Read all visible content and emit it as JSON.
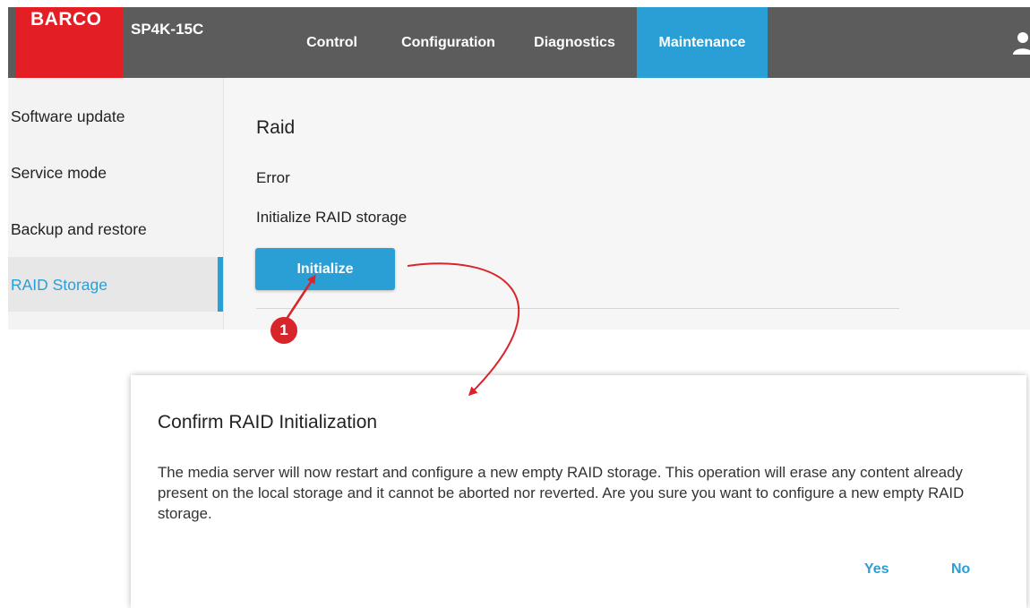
{
  "header": {
    "logo_text": "BARCO",
    "model": "SP4K-15C",
    "tabs": [
      {
        "label": "Control"
      },
      {
        "label": "Configuration"
      },
      {
        "label": "Diagnostics"
      },
      {
        "label": "Maintenance",
        "active": true
      }
    ],
    "user_icon": "user-icon"
  },
  "sidebar": {
    "items": [
      {
        "label": "Software update"
      },
      {
        "label": "Service mode"
      },
      {
        "label": "Backup and restore"
      },
      {
        "label": "RAID Storage",
        "active": true
      }
    ]
  },
  "main": {
    "title": "Raid",
    "status": "Error",
    "init_label": "Initialize RAID storage",
    "init_button": "Initialize"
  },
  "annotation": {
    "badge": "1"
  },
  "dialog": {
    "title": "Confirm RAID Initialization",
    "message": "The media server will now restart and configure a new empty RAID storage. This operation will erase any content already present on the local storage and it cannot be aborted nor reverted. Are you sure you want to configure a new empty RAID storage.",
    "yes_label": "Yes",
    "no_label": "No"
  },
  "colors": {
    "accent": "#2a9fd6",
    "header_bg": "#5c5c5c",
    "brand_red": "#e31e24",
    "annotation_red": "#d7252b"
  }
}
